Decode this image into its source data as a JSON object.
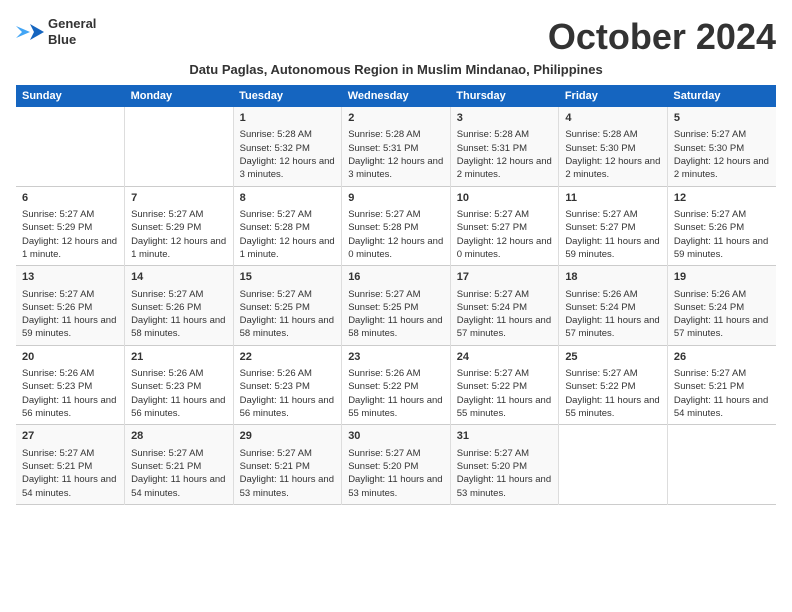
{
  "header": {
    "logo_line1": "General",
    "logo_line2": "Blue",
    "month": "October 2024",
    "subtitle": "Datu Paglas, Autonomous Region in Muslim Mindanao, Philippines"
  },
  "weekdays": [
    "Sunday",
    "Monday",
    "Tuesday",
    "Wednesday",
    "Thursday",
    "Friday",
    "Saturday"
  ],
  "weeks": [
    [
      {
        "day": "",
        "content": ""
      },
      {
        "day": "",
        "content": ""
      },
      {
        "day": "1",
        "content": "Sunrise: 5:28 AM\nSunset: 5:32 PM\nDaylight: 12 hours and 3 minutes."
      },
      {
        "day": "2",
        "content": "Sunrise: 5:28 AM\nSunset: 5:31 PM\nDaylight: 12 hours and 3 minutes."
      },
      {
        "day": "3",
        "content": "Sunrise: 5:28 AM\nSunset: 5:31 PM\nDaylight: 12 hours and 2 minutes."
      },
      {
        "day": "4",
        "content": "Sunrise: 5:28 AM\nSunset: 5:30 PM\nDaylight: 12 hours and 2 minutes."
      },
      {
        "day": "5",
        "content": "Sunrise: 5:27 AM\nSunset: 5:30 PM\nDaylight: 12 hours and 2 minutes."
      }
    ],
    [
      {
        "day": "6",
        "content": "Sunrise: 5:27 AM\nSunset: 5:29 PM\nDaylight: 12 hours and 1 minute."
      },
      {
        "day": "7",
        "content": "Sunrise: 5:27 AM\nSunset: 5:29 PM\nDaylight: 12 hours and 1 minute."
      },
      {
        "day": "8",
        "content": "Sunrise: 5:27 AM\nSunset: 5:28 PM\nDaylight: 12 hours and 1 minute."
      },
      {
        "day": "9",
        "content": "Sunrise: 5:27 AM\nSunset: 5:28 PM\nDaylight: 12 hours and 0 minutes."
      },
      {
        "day": "10",
        "content": "Sunrise: 5:27 AM\nSunset: 5:27 PM\nDaylight: 12 hours and 0 minutes."
      },
      {
        "day": "11",
        "content": "Sunrise: 5:27 AM\nSunset: 5:27 PM\nDaylight: 11 hours and 59 minutes."
      },
      {
        "day": "12",
        "content": "Sunrise: 5:27 AM\nSunset: 5:26 PM\nDaylight: 11 hours and 59 minutes."
      }
    ],
    [
      {
        "day": "13",
        "content": "Sunrise: 5:27 AM\nSunset: 5:26 PM\nDaylight: 11 hours and 59 minutes."
      },
      {
        "day": "14",
        "content": "Sunrise: 5:27 AM\nSunset: 5:26 PM\nDaylight: 11 hours and 58 minutes."
      },
      {
        "day": "15",
        "content": "Sunrise: 5:27 AM\nSunset: 5:25 PM\nDaylight: 11 hours and 58 minutes."
      },
      {
        "day": "16",
        "content": "Sunrise: 5:27 AM\nSunset: 5:25 PM\nDaylight: 11 hours and 58 minutes."
      },
      {
        "day": "17",
        "content": "Sunrise: 5:27 AM\nSunset: 5:24 PM\nDaylight: 11 hours and 57 minutes."
      },
      {
        "day": "18",
        "content": "Sunrise: 5:26 AM\nSunset: 5:24 PM\nDaylight: 11 hours and 57 minutes."
      },
      {
        "day": "19",
        "content": "Sunrise: 5:26 AM\nSunset: 5:24 PM\nDaylight: 11 hours and 57 minutes."
      }
    ],
    [
      {
        "day": "20",
        "content": "Sunrise: 5:26 AM\nSunset: 5:23 PM\nDaylight: 11 hours and 56 minutes."
      },
      {
        "day": "21",
        "content": "Sunrise: 5:26 AM\nSunset: 5:23 PM\nDaylight: 11 hours and 56 minutes."
      },
      {
        "day": "22",
        "content": "Sunrise: 5:26 AM\nSunset: 5:23 PM\nDaylight: 11 hours and 56 minutes."
      },
      {
        "day": "23",
        "content": "Sunrise: 5:26 AM\nSunset: 5:22 PM\nDaylight: 11 hours and 55 minutes."
      },
      {
        "day": "24",
        "content": "Sunrise: 5:27 AM\nSunset: 5:22 PM\nDaylight: 11 hours and 55 minutes."
      },
      {
        "day": "25",
        "content": "Sunrise: 5:27 AM\nSunset: 5:22 PM\nDaylight: 11 hours and 55 minutes."
      },
      {
        "day": "26",
        "content": "Sunrise: 5:27 AM\nSunset: 5:21 PM\nDaylight: 11 hours and 54 minutes."
      }
    ],
    [
      {
        "day": "27",
        "content": "Sunrise: 5:27 AM\nSunset: 5:21 PM\nDaylight: 11 hours and 54 minutes."
      },
      {
        "day": "28",
        "content": "Sunrise: 5:27 AM\nSunset: 5:21 PM\nDaylight: 11 hours and 54 minutes."
      },
      {
        "day": "29",
        "content": "Sunrise: 5:27 AM\nSunset: 5:21 PM\nDaylight: 11 hours and 53 minutes."
      },
      {
        "day": "30",
        "content": "Sunrise: 5:27 AM\nSunset: 5:20 PM\nDaylight: 11 hours and 53 minutes."
      },
      {
        "day": "31",
        "content": "Sunrise: 5:27 AM\nSunset: 5:20 PM\nDaylight: 11 hours and 53 minutes."
      },
      {
        "day": "",
        "content": ""
      },
      {
        "day": "",
        "content": ""
      }
    ]
  ]
}
